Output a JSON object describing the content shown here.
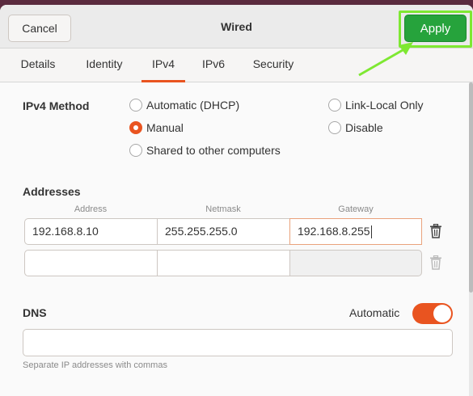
{
  "header": {
    "cancel_label": "Cancel",
    "title": "Wired",
    "apply_label": "Apply"
  },
  "tabs": [
    {
      "label": "Details"
    },
    {
      "label": "Identity"
    },
    {
      "label": "IPv4",
      "active": true
    },
    {
      "label": "IPv6"
    },
    {
      "label": "Security"
    }
  ],
  "ipv4_method": {
    "label": "IPv4 Method",
    "options": [
      {
        "label": "Automatic (DHCP)",
        "checked": false
      },
      {
        "label": "Manual",
        "checked": true
      },
      {
        "label": "Shared to other computers",
        "checked": false
      },
      {
        "label": "Link-Local Only",
        "checked": false
      },
      {
        "label": "Disable",
        "checked": false
      }
    ]
  },
  "addresses": {
    "label": "Addresses",
    "columns": [
      "Address",
      "Netmask",
      "Gateway"
    ],
    "rows": [
      {
        "address": "192.168.8.10",
        "netmask": "255.255.255.0",
        "gateway": "192.168.8.255"
      },
      {
        "address": "",
        "netmask": "",
        "gateway": ""
      }
    ]
  },
  "dns": {
    "label": "DNS",
    "automatic_label": "Automatic",
    "automatic_on": true,
    "value": "",
    "hint": "Separate IP addresses with commas"
  },
  "colors": {
    "accent": "#e95420",
    "apply_button": "#26a33c",
    "highlight": "#7ee832"
  }
}
